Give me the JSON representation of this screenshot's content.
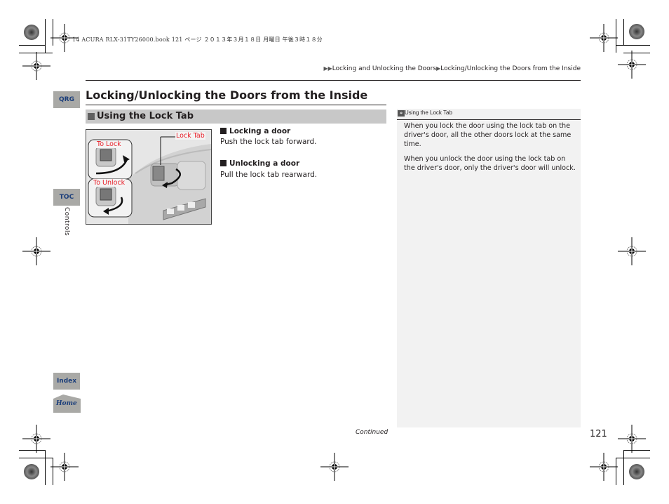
{
  "print_info": {
    "line": "14 ACURA RLX-31TY26000.book  121 ページ  ２０１３年３月１８日  月曜日  午後３時１８分"
  },
  "breadcrumb": {
    "items": [
      "Locking and Unlocking the Doors",
      "Locking/Unlocking the Doors from the Inside"
    ],
    "separator_icon": "triangle-right-icon"
  },
  "page_title": "Locking/Unlocking the Doors from the Inside",
  "section": {
    "title": "Using the Lock Tab"
  },
  "figure": {
    "labels": {
      "lock_tab": "Lock Tab",
      "to_lock": "To Lock",
      "to_unlock": "To Unlock"
    },
    "label_color": "#e8202a"
  },
  "steps": [
    {
      "title": "Locking a door",
      "text": "Push the lock tab forward."
    },
    {
      "title": "Unlocking a door",
      "text": "Pull the lock tab rearward."
    }
  ],
  "note": {
    "title": "Using the Lock Tab",
    "paragraphs": [
      "When you lock the door using the lock tab on the driver's door, all the other doors lock at the same time.",
      "When you unlock the door using the lock tab on the driver's door, only the driver's door will unlock."
    ]
  },
  "side_nav": {
    "qrg": "QRG",
    "toc": "TOC",
    "chapter": "Controls",
    "index": "Index",
    "home": "Home",
    "tab_text_color": "#1a3d7a",
    "tab_bg_color": "#a9a9a6"
  },
  "footer": {
    "continued": "Continued",
    "page_number": "121"
  }
}
